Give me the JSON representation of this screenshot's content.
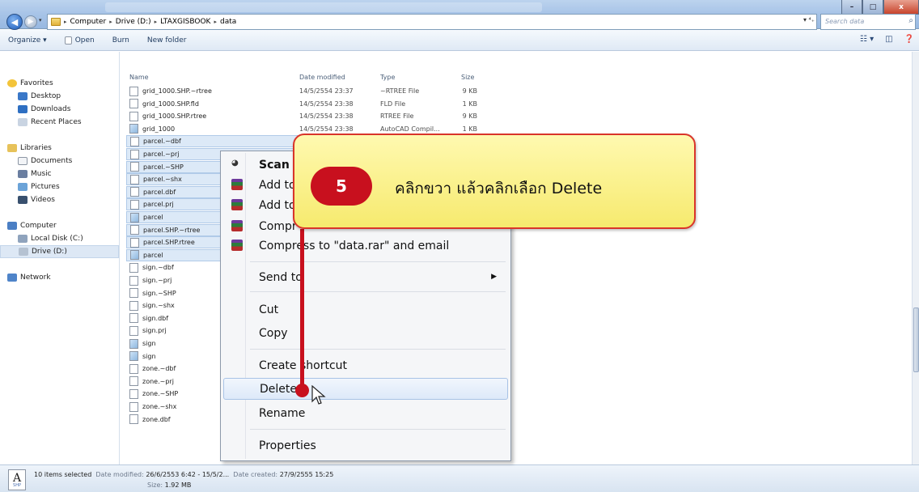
{
  "window": {
    "minimize": "–",
    "maximize": "□",
    "close": "x"
  },
  "nav": {
    "back": "◀",
    "forward": "▶",
    "dropdown": "▾"
  },
  "address": {
    "crumbs": [
      "Computer",
      "Drive (D:)",
      "LTAXGISBOOK",
      "data"
    ],
    "separator": "▸",
    "dropdown": "▾ ⁴₊"
  },
  "search": {
    "placeholder": "Search data",
    "icon": "⌕"
  },
  "toolbar": {
    "organize": "Organize ▾",
    "open": "Open",
    "burn": "Burn",
    "new_folder": "New folder",
    "views": "☷ ▾",
    "preview": "◫",
    "help": "❓"
  },
  "navpane": {
    "favorites": "Favorites",
    "desktop": "Desktop",
    "downloads": "Downloads",
    "recent": "Recent Places",
    "libraries": "Libraries",
    "documents": "Documents",
    "music": "Music",
    "pictures": "Pictures",
    "videos": "Videos",
    "computer": "Computer",
    "local_disk": "Local Disk (C:)",
    "drive_d": "Drive (D:)",
    "network": "Network"
  },
  "columns": {
    "name": "Name",
    "date": "Date modified",
    "type": "Type",
    "size": "Size"
  },
  "files": [
    {
      "name": "grid_1000.SHP.~rtree",
      "date": "14/5/2554 23:37",
      "type": "~RTREE File",
      "size": "9 KB",
      "sel": false,
      "img": false
    },
    {
      "name": "grid_1000.SHP.fld",
      "date": "14/5/2554 23:38",
      "type": "FLD File",
      "size": "1 KB",
      "sel": false,
      "img": false
    },
    {
      "name": "grid_1000.SHP.rtree",
      "date": "14/5/2554 23:38",
      "type": "RTREE File",
      "size": "9 KB",
      "sel": false,
      "img": false
    },
    {
      "name": "grid_1000",
      "date": "14/5/2554 23:38",
      "type": "AutoCAD Compil...",
      "size": "1 KB",
      "sel": false,
      "img": true
    },
    {
      "name": "parcel.~dbf",
      "sel": true,
      "img": false
    },
    {
      "name": "parcel.~prj",
      "sel": true,
      "img": false
    },
    {
      "name": "parcel.~SHP",
      "sel": true,
      "img": false
    },
    {
      "name": "parcel.~shx",
      "sel": true,
      "img": false
    },
    {
      "name": "parcel.dbf",
      "sel": true,
      "img": false
    },
    {
      "name": "parcel.prj",
      "sel": true,
      "img": false
    },
    {
      "name": "parcel",
      "sel": true,
      "img": true
    },
    {
      "name": "parcel.SHP.~rtree",
      "sel": true,
      "img": false
    },
    {
      "name": "parcel.SHP.rtree",
      "sel": true,
      "img": false
    },
    {
      "name": "parcel",
      "sel": true,
      "img": true
    },
    {
      "name": "sign.~dbf",
      "sel": false,
      "img": false
    },
    {
      "name": "sign.~prj",
      "sel": false,
      "img": false
    },
    {
      "name": "sign.~SHP",
      "sel": false,
      "img": false
    },
    {
      "name": "sign.~shx",
      "sel": false,
      "img": false
    },
    {
      "name": "sign.dbf",
      "sel": false,
      "img": false
    },
    {
      "name": "sign.prj",
      "sel": false,
      "img": false
    },
    {
      "name": "sign",
      "sel": false,
      "img": true
    },
    {
      "name": "sign",
      "sel": false,
      "img": true
    },
    {
      "name": "zone.~dbf",
      "sel": false,
      "img": false
    },
    {
      "name": "zone.~prj",
      "sel": false,
      "img": false
    },
    {
      "name": "zone.~SHP",
      "sel": false,
      "img": false
    },
    {
      "name": "zone.~shx",
      "sel": false,
      "img": false
    },
    {
      "name": "zone.dbf",
      "sel": false,
      "img": false
    }
  ],
  "context_menu": {
    "scan": "Scan w",
    "add_to_1": "Add to",
    "add_to_2": "Add to",
    "compress_1": "Compr",
    "compress_email": "Compress to \"data.rar\" and email",
    "send_to": "Send to",
    "submenu_arrow": "▶",
    "cut": "Cut",
    "copy": "Copy",
    "create_shortcut": "Create shortcut",
    "delete": "Delete",
    "rename": "Rename",
    "properties": "Properties"
  },
  "callout": {
    "step": "5",
    "text": "คลิกขวา แล้วคลิกเลือก Delete"
  },
  "status": {
    "icon_letter": "A",
    "icon_sub": "SHP",
    "selected": "10 items selected",
    "date_modified_label": "Date modified:",
    "date_modified": "26/6/2553 6:42 - 15/5/2...",
    "date_created_label": "Date created:",
    "date_created": "27/9/2555 15:25",
    "size_label": "Size:",
    "size": "1.92 MB"
  }
}
